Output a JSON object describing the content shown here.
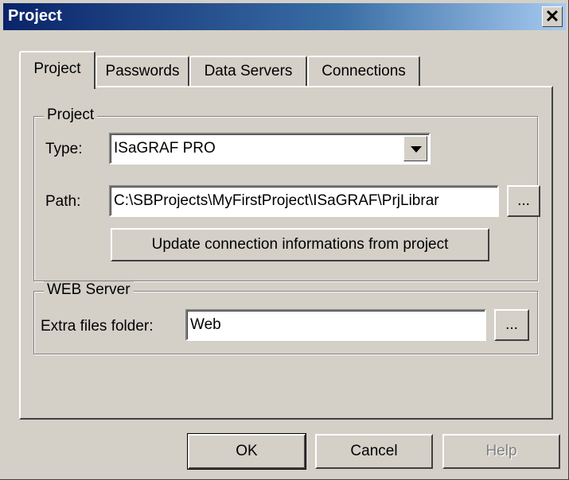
{
  "window": {
    "title": "Project",
    "close_icon": "close-icon",
    "close_glyph": "✕"
  },
  "tabs": [
    {
      "label": "Project",
      "active": true
    },
    {
      "label": "Passwords",
      "active": false
    },
    {
      "label": "Data Servers",
      "active": false
    },
    {
      "label": "Connections",
      "active": false
    }
  ],
  "project_group": {
    "legend": "Project",
    "type_label": "Type:",
    "type_value": "ISaGRAF PRO",
    "path_label": "Path:",
    "path_value": "C:\\SBProjects\\MyFirstProject\\ISaGRAF\\PrjLibrar",
    "browse_label": "...",
    "update_label": "Update connection informations from project"
  },
  "web_group": {
    "legend": "WEB Server",
    "extra_label": "Extra files folder:",
    "extra_value": "Web",
    "browse_label": "..."
  },
  "footer": {
    "ok_label": "OK",
    "cancel_label": "Cancel",
    "help_label": "Help"
  }
}
